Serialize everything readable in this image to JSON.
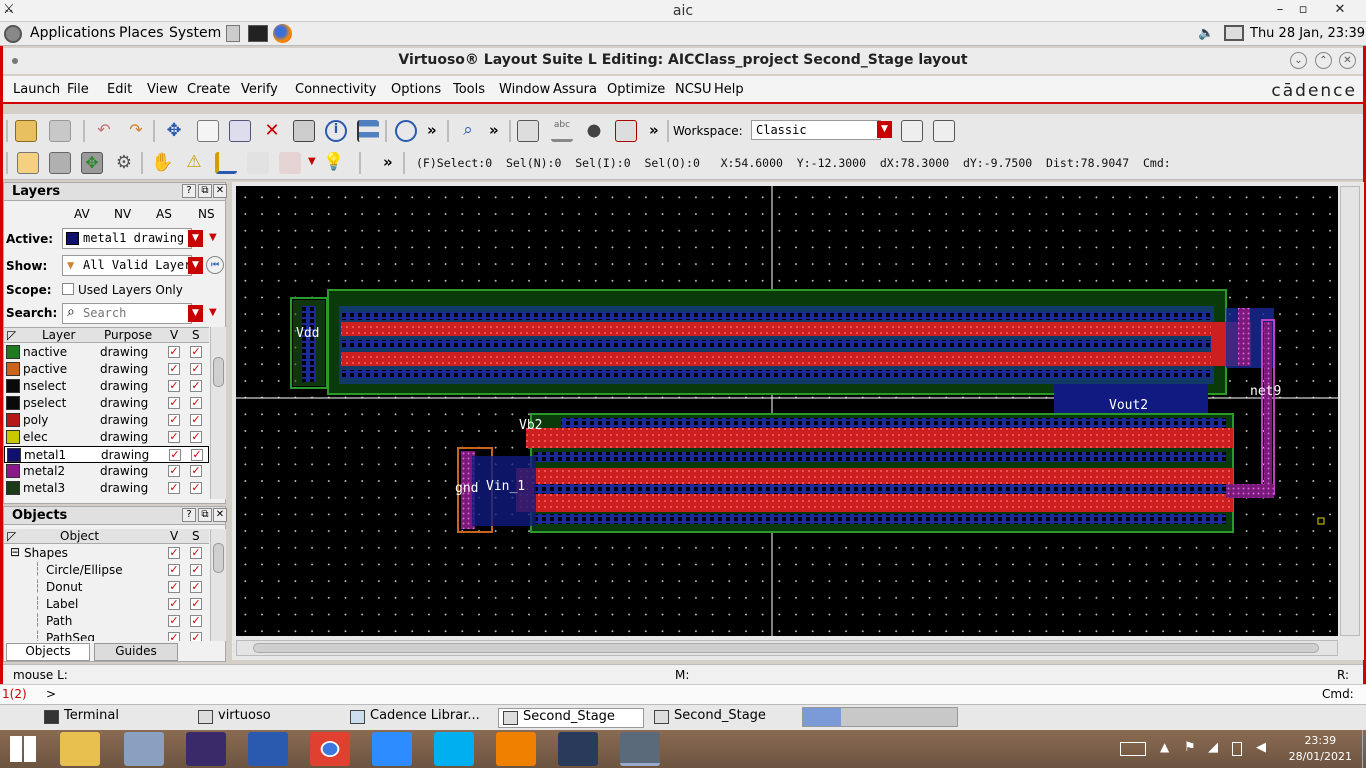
{
  "window_title": "aic",
  "panel": {
    "menus": [
      "Applications",
      "Places",
      "System"
    ],
    "clock": "Thu 28 Jan, 23:39"
  },
  "app_title": "Virtuoso® Layout Suite L Editing: AICClass_project Second_Stage layout",
  "menu": [
    "Launch",
    "File",
    "Edit",
    "View",
    "Create",
    "Verify",
    "Connectivity",
    "Options",
    "Tools",
    "Window",
    "Assura",
    "Optimize",
    "NCSU",
    "Help"
  ],
  "brand": "cādence",
  "toolbar": {
    "workspace_label": "Workspace:",
    "workspace_value": "Classic",
    "more": "»"
  },
  "status_line": "(F)Select:0  Sel(N):0  Sel(I):0  Sel(O):0   X:54.6000  Y:-12.3000  dX:78.3000  dY:-9.7500  Dist:78.9047  Cmd:",
  "layers_panel": {
    "title": "Layers",
    "cols": [
      "AV",
      "NV",
      "AS",
      "NS"
    ],
    "active_label": "Active:",
    "active_value": "metal1 drawing",
    "show_label": "Show:",
    "show_value": "All Valid Layer",
    "scope_label": "Scope:",
    "scope_value": "Used Layers Only",
    "search_label": "Search:",
    "search_placeholder": "Search",
    "table_headers": [
      "Layer",
      "Purpose",
      "V",
      "S"
    ],
    "rows": [
      {
        "layer": "nactive",
        "purpose": "drawing",
        "color": "#1f7a1f"
      },
      {
        "layer": "pactive",
        "purpose": "drawing",
        "color": "#c8641e"
      },
      {
        "layer": "nselect",
        "purpose": "drawing",
        "color": "#0a0a0a"
      },
      {
        "layer": "pselect",
        "purpose": "drawing",
        "color": "#0a0a0a"
      },
      {
        "layer": "poly",
        "purpose": "drawing",
        "color": "#b41818"
      },
      {
        "layer": "elec",
        "purpose": "drawing",
        "color": "#c8c800"
      },
      {
        "layer": "metal1",
        "purpose": "drawing",
        "color": "#101070"
      },
      {
        "layer": "metal2",
        "purpose": "drawing",
        "color": "#8a1a8a"
      },
      {
        "layer": "metal3",
        "purpose": "drawing",
        "color": "#1a3a1a"
      }
    ]
  },
  "objects_panel": {
    "title": "Objects",
    "table_headers": [
      "Object",
      "V",
      "S"
    ],
    "rows": [
      "Shapes",
      "Circle/Ellipse",
      "Donut",
      "Label",
      "Path",
      "PathSeg"
    ],
    "tabs": [
      "Objects",
      "Guides"
    ]
  },
  "canvas_labels": [
    "Vdd",
    "Vout2",
    "net9",
    "Vb2",
    "gnd",
    "Vin_1"
  ],
  "mouse_bar": {
    "left": "mouse L:",
    "mid": "M:",
    "right": "R:"
  },
  "cmd_bar": {
    "left": "1(2)",
    "prompt": ">",
    "right": "Cmd:"
  },
  "tasks": [
    "Terminal",
    "virtuoso",
    "Cadence Librar...",
    "Second_Stage",
    "Second_Stage"
  ],
  "win_clock": {
    "time": "23:39",
    "date": "28/01/2021"
  }
}
